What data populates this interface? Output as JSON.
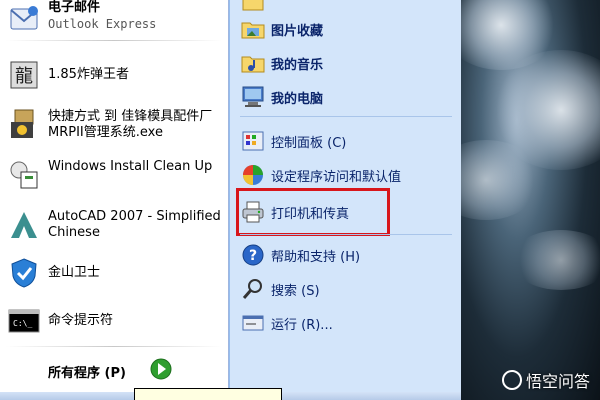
{
  "start_menu": {
    "left_items": [
      {
        "icon": "outlook-express-icon",
        "title": "电子邮件",
        "subtitle": "Outlook Express"
      },
      {
        "icon": "game-icon",
        "title": "1.85炸弹王者"
      },
      {
        "icon": "shortcut-icon",
        "title": "快捷方式 到 佳锋模具配件厂MRPII管理系统.exe"
      },
      {
        "icon": "cleanup-icon",
        "title": "Windows Install Clean Up"
      },
      {
        "icon": "autocad-icon",
        "title": "AutoCAD 2007 - Simplified Chinese"
      },
      {
        "icon": "shield-icon",
        "title": "金山卫士"
      },
      {
        "icon": "cmd-icon",
        "title": "命令提示符"
      }
    ],
    "all_programs": "所有程序 (P)",
    "right_items": [
      {
        "icon": "pictures-folder-icon",
        "label": "图片收藏"
      },
      {
        "icon": "music-folder-icon",
        "label": "我的音乐"
      },
      {
        "icon": "my-computer-icon",
        "label": "我的电脑"
      },
      {
        "icon": "control-panel-icon",
        "label": "控制面板 (C)"
      },
      {
        "icon": "program-access-icon",
        "label": "设定程序访问和默认值"
      },
      {
        "icon": "printer-icon",
        "label": "打印机和传真"
      },
      {
        "icon": "help-icon",
        "label": "帮助和支持 (H)"
      },
      {
        "icon": "search-icon",
        "label": "搜索 (S)"
      },
      {
        "icon": "run-icon",
        "label": "运行 (R)..."
      }
    ]
  },
  "highlight": {
    "target": "打印机和传真",
    "color": "#d8161b"
  },
  "watermark": {
    "text": "悟空问答"
  }
}
